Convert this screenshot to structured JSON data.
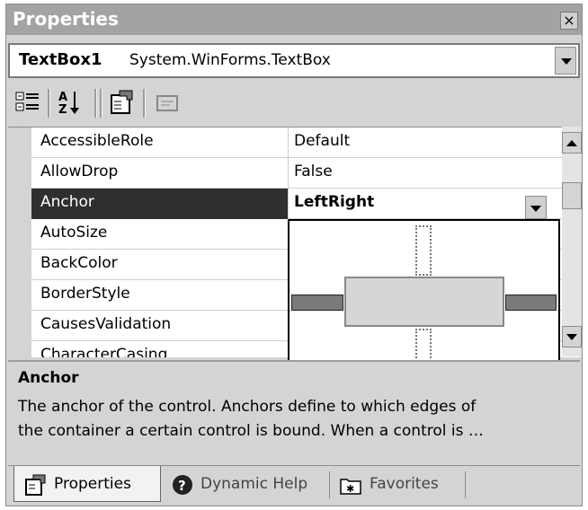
{
  "window": {
    "title": "Properties",
    "close_glyph": "×"
  },
  "selector": {
    "name": "TextBox1",
    "type": "System.WinForms.TextBox"
  },
  "toolbar": {
    "icons": [
      "categorized-icon",
      "alphabetical-icon",
      "properties-icon",
      "events-icon"
    ]
  },
  "grid": {
    "rows": [
      {
        "name": "AccessibleRole",
        "value": "Default"
      },
      {
        "name": "AllowDrop",
        "value": "False"
      },
      {
        "name": "Anchor",
        "value": "LeftRight",
        "selected": true
      },
      {
        "name": "AutoSize",
        "value": ""
      },
      {
        "name": "BackColor",
        "value": ""
      },
      {
        "name": "BorderStyle",
        "value": ""
      },
      {
        "name": "CausesValidation",
        "value": ""
      },
      {
        "name": "CharacterCasing",
        "value": ""
      }
    ]
  },
  "anchor_editor": {
    "left": true,
    "right": true,
    "top": false,
    "bottom": false
  },
  "description": {
    "title": "Anchor",
    "line1": "The anchor of the control. Anchors define to which edges of",
    "line2": "the container a certain control is bound. When a control is  …"
  },
  "tabs": [
    {
      "label": "Properties",
      "active": true
    },
    {
      "label": "Dynamic Help",
      "active": false
    },
    {
      "label": "Favorites",
      "active": false
    }
  ],
  "colors": {
    "selected_row": "#2f2f2f",
    "panel": "#d4d4d4",
    "title_bar": "#a3a3a3"
  }
}
